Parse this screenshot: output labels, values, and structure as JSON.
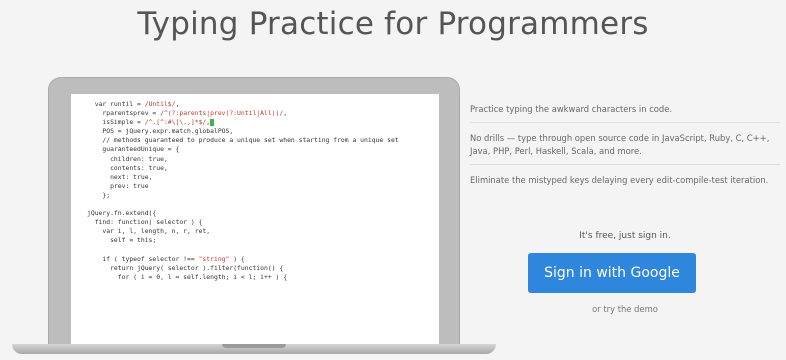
{
  "header": {
    "title": "Typing Practice for Programmers"
  },
  "code_sample": {
    "lines": [
      "  var runtil = /Until$/,",
      "    rparentsprev = /^(?:parents|prev(?:Until|All))/,",
      "    isSimple = /^.[^:#\\[\\.,]*$/,",
      "    POS = jQuery.expr.match.globalPOS,",
      "    // methods guaranteed to produce a unique set when starting from a unique set",
      "    guaranteedUnique = {",
      "      children: true,",
      "      contents: true,",
      "      next: true,",
      "      prev: true",
      "    };",
      "",
      "jQuery.fn.extend({",
      "  find: function( selector ) {",
      "    var i, l, length, n, r, ret,",
      "      self = this;",
      "",
      "    if ( typeof selector !== \"string\" ) {",
      "      return jQuery( selector ).filter(function() {",
      "        for ( i = 0, l = self.length; i < l; i++ ) {"
    ],
    "cursor_color": "#3fb54a",
    "string_color": "#c0392b"
  },
  "features": [
    "Practice typing the awkward characters in code.",
    "No drills — type through open source code in JavaScript, Ruby, C, C++, Java, PHP, Perl, Haskell, Scala, and more.",
    "Eliminate the mistyped keys delaying every edit-compile-test iteration."
  ],
  "signup": {
    "free_text": "It's free, just sign in.",
    "button_label": "Sign in with Google",
    "demo_link": "or try the demo",
    "button_color": "#2f86dd"
  }
}
